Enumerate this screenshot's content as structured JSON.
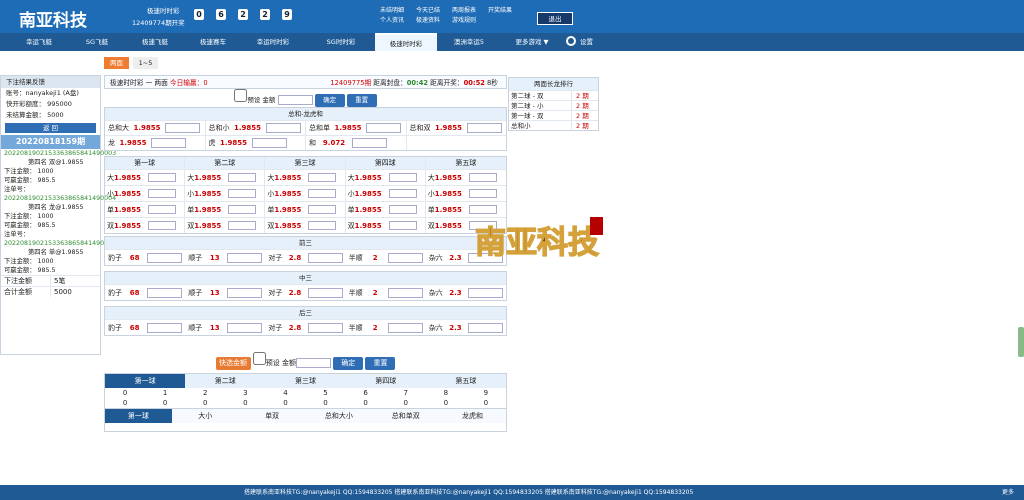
{
  "header": {
    "brand": "南亚科技",
    "round_label": "极速时时彩",
    "round_sub": "12409774期开奖",
    "balls": [
      "0",
      "6",
      "2",
      "2",
      "9"
    ],
    "links": [
      "未结明细",
      "今天已结",
      "两周报表",
      "开奖结果",
      "个人资讯",
      "极速资料",
      "游戏规则"
    ],
    "exit": "退出"
  },
  "nav": {
    "tabs": [
      "幸运飞艇",
      "SG飞艇",
      "极速飞艇",
      "极速赛车",
      "幸运时时彩",
      "SG时时彩",
      "极速时时彩",
      "澳洲幸运5",
      "更多游戏 ▼"
    ],
    "settings": "设置"
  },
  "subtabs": [
    "两面",
    "1~5"
  ],
  "left": {
    "title": "下注结果反馈",
    "account": "账号：nanyakeji1 (A盘)",
    "quota": "快开彩额度：   995000",
    "unsettled": "未结算金额：   5000",
    "return": "返 回",
    "date": "20220818159期",
    "tickets": [
      {
        "no": "2022081902153363865841490003",
        "bet": "第四名 双@1.9855",
        "amount": "下注金额：   1000",
        "win": "可赢金额：   985.5"
      },
      {
        "no": "2022081902153363865841490004",
        "bet": "第四名 龙@1.9855",
        "amount": "下注金额：   1000",
        "win": "可赢金额：   985.5"
      },
      {
        "no": "2022081902153363865841490005",
        "bet": "第四名 单@1.9855",
        "amount": "下注金额：   1000",
        "win": "可赢金额：   985.5"
      }
    ],
    "order_label": "注单号：",
    "summary": [
      [
        "下注金额",
        "5笔"
      ],
      [
        "合计金额",
        "5000"
      ]
    ]
  },
  "main": {
    "status_left": "极速时时彩 一 两面",
    "status_win": "今日输赢：0",
    "period": "12409775期",
    "close_label": "距离封盘：",
    "close_time": "00:42",
    "open_label": "距离开奖：",
    "open_time": "00:52",
    "seconds": "8秒",
    "preset": "预设",
    "amount": "金额",
    "confirm": "确定",
    "reset": "重置"
  },
  "sum_section": {
    "title": "总和-龙虎和",
    "rows": [
      [
        [
          "总和大",
          "1.9855"
        ],
        [
          "总和小",
          "1.9855"
        ],
        [
          "总和单",
          "1.9855"
        ],
        [
          "总和双",
          "1.9855"
        ]
      ],
      [
        [
          "龙",
          "1.9855"
        ],
        [
          "虎",
          "1.9855"
        ],
        [
          "和",
          "9.072"
        ],
        [
          "",
          ""
        ]
      ]
    ]
  },
  "balls_section": {
    "columns": [
      "第一球",
      "第二球",
      "第三球",
      "第四球",
      "第五球"
    ],
    "rows": [
      [
        "大",
        "1.9855"
      ],
      [
        "小",
        "1.9855"
      ],
      [
        "单",
        "1.9855"
      ],
      [
        "双",
        "1.9855"
      ]
    ]
  },
  "combo_sections": [
    {
      "title": "前三",
      "items": [
        [
          "豹子",
          "68"
        ],
        [
          "顺子",
          "13"
        ],
        [
          "对子",
          "2.8"
        ],
        [
          "半顺",
          "2"
        ],
        [
          "杂六",
          "2.3"
        ]
      ]
    },
    {
      "title": "中三",
      "items": [
        [
          "豹子",
          "68"
        ],
        [
          "顺子",
          "13"
        ],
        [
          "对子",
          "2.8"
        ],
        [
          "半顺",
          "2"
        ],
        [
          "杂六",
          "2.3"
        ]
      ]
    },
    {
      "title": "后三",
      "items": [
        [
          "豹子",
          "68"
        ],
        [
          "顺子",
          "13"
        ],
        [
          "对子",
          "2.8"
        ],
        [
          "半顺",
          "2"
        ],
        [
          "杂六",
          "2.3"
        ]
      ]
    }
  ],
  "quick": {
    "label": "快选金额"
  },
  "stats": {
    "tabs": [
      "第一球",
      "第二球",
      "第三球",
      "第四球",
      "第五球"
    ],
    "nums": [
      "0",
      "1",
      "2",
      "3",
      "4",
      "5",
      "6",
      "7",
      "8",
      "9"
    ],
    "vals": [
      "0",
      "0",
      "0",
      "0",
      "0",
      "0",
      "0",
      "0",
      "0",
      "0"
    ],
    "foot": [
      "第一球",
      "大小",
      "单双",
      "总和大小",
      "总和单双",
      "龙虎和"
    ]
  },
  "rank": {
    "title": "两面长龙排行",
    "items": [
      [
        "第二球 - 双",
        "2 期"
      ],
      [
        "第二球 - 小",
        "2 期"
      ],
      [
        "第一球 - 双",
        "2 期"
      ],
      [
        "总和小",
        "2 期"
      ]
    ]
  },
  "footer": {
    "text": "搭建联系南亚科技TG:@nanyakeji1 QQ:1594833205 搭建联系南亚科技TG:@nanyakeji1 QQ:1594833205 搭建联系南亚科技TG:@nanyakeji1 QQ:1594833205",
    "more": "更多"
  },
  "colors": {
    "primary": "#1f6cb6",
    "nav": "#1f5a95",
    "odds": "#c00"
  }
}
